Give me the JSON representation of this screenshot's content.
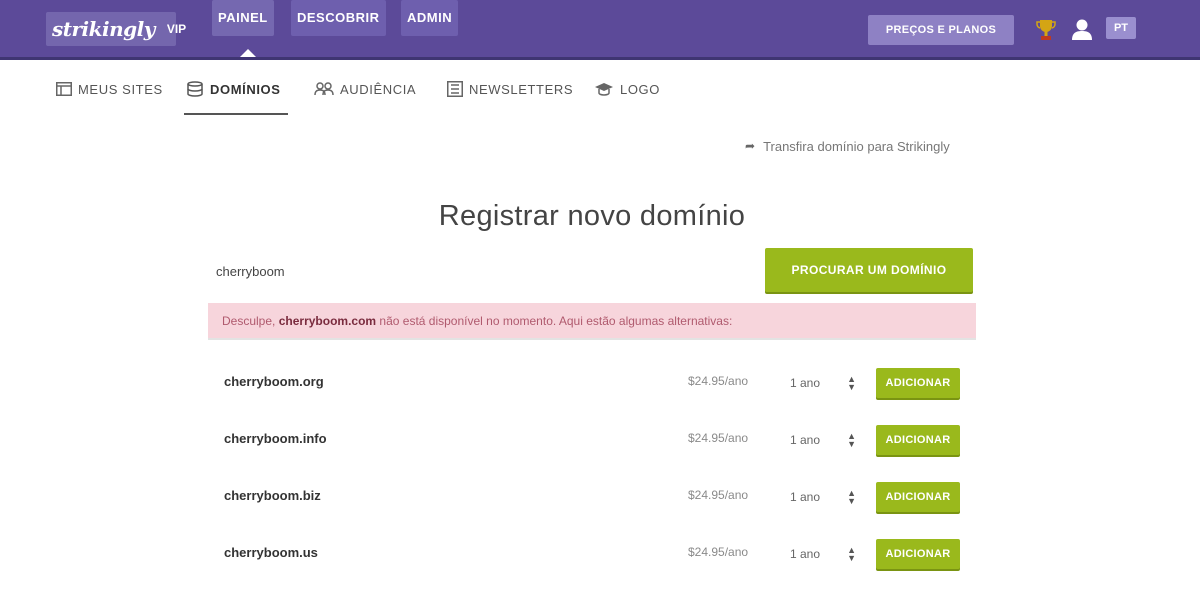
{
  "topbar": {
    "logo_text": "strikingly",
    "logo_badge": "VIP",
    "nav": [
      "PAINEL",
      "DESCOBRIR",
      "ADMIN"
    ],
    "plans_label": "PREÇOS E PLANOS",
    "lang_label": "PT"
  },
  "subnav": {
    "items": [
      "MEUS SITES",
      "DOMÍNIOS",
      "AUDIÊNCIA",
      "NEWSLETTERS",
      "LOGO"
    ],
    "active": "DOMÍNIOS"
  },
  "transfer_link": "Transfira domínio para Strikingly",
  "page_title": "Registrar novo domínio",
  "search": {
    "value": "cherryboom",
    "button_label": "PROCURAR UM DOMÍNIO"
  },
  "alert": {
    "prefix": "Desculpe,",
    "domain": "cherryboom.com",
    "message": "não está disponível no momento. Aqui estão algumas alternativas:"
  },
  "domains": [
    {
      "name": "cherryboom.org",
      "price": "$24.95/ano",
      "period": "1 ano",
      "button": "ADICIONAR"
    },
    {
      "name": "cherryboom.info",
      "price": "$24.95/ano",
      "period": "1 ano",
      "button": "ADICIONAR"
    },
    {
      "name": "cherryboom.biz",
      "price": "$24.95/ano",
      "period": "1 ano",
      "button": "ADICIONAR"
    },
    {
      "name": "cherryboom.us",
      "price": "$24.95/ano",
      "period": "1 ano",
      "button": "ADICIONAR"
    }
  ],
  "colors": {
    "topbar": "#5c4a99",
    "accent_green": "#9ab91c",
    "alert_bg": "#f7d5dc"
  }
}
